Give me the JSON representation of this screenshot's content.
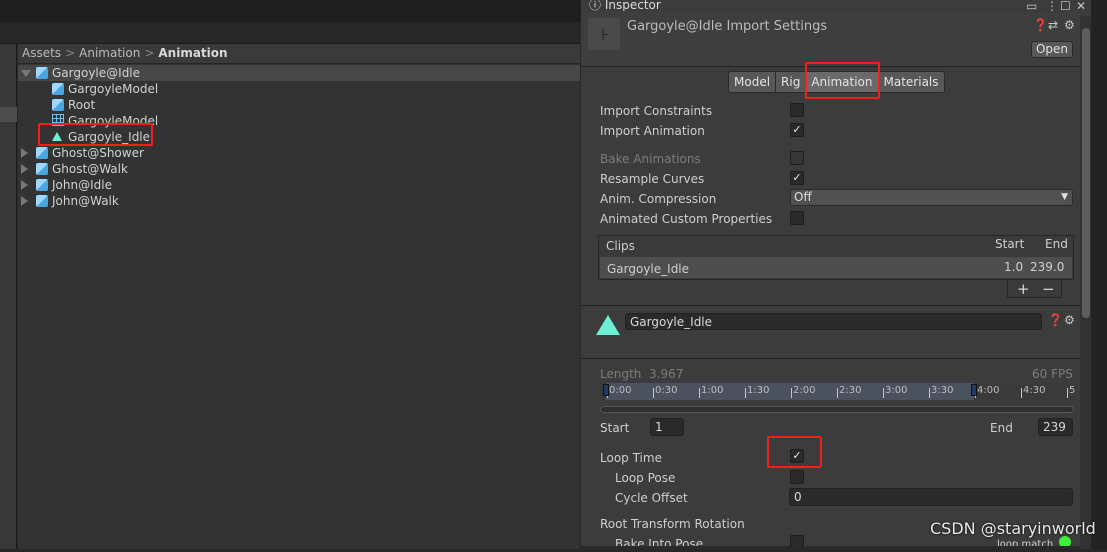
{
  "breadcrumb": [
    "Assets",
    "Animation",
    "Animation"
  ],
  "tree": [
    {
      "label": "Gargoyle@Idle",
      "icon": "model-prefab-icon",
      "expanded": true,
      "selected": true,
      "depth": 0
    },
    {
      "label": "GargoyleModel",
      "icon": "model-prefab-icon",
      "depth": 1
    },
    {
      "label": "Root",
      "icon": "model-prefab-icon",
      "depth": 1
    },
    {
      "label": "GargoyleModel",
      "icon": "mesh-icon",
      "depth": 1
    },
    {
      "label": "Gargoyle_Idle",
      "icon": "animation-clip-icon",
      "depth": 1,
      "highlighted": true
    },
    {
      "label": "Ghost@Shower",
      "icon": "model-prefab-icon",
      "expanded": false,
      "depth": 0
    },
    {
      "label": "Ghost@Walk",
      "icon": "model-prefab-icon",
      "expanded": false,
      "depth": 0
    },
    {
      "label": "John@Idle",
      "icon": "model-prefab-icon",
      "expanded": false,
      "depth": 0
    },
    {
      "label": "John@Walk",
      "icon": "model-prefab-icon",
      "expanded": false,
      "depth": 0
    }
  ],
  "inspector": {
    "tab_label": "Inspector",
    "title": "Gargoyle@Idle Import Settings",
    "open_label": "Open",
    "tabs": [
      "Model",
      "Rig",
      "Animation",
      "Materials"
    ],
    "active_tab": "Animation",
    "settings": [
      {
        "label": "Import Constraints",
        "checked": false
      },
      {
        "label": "Import Animation",
        "checked": true
      },
      {
        "label": "Bake Animations",
        "checked": false,
        "disabled": true
      },
      {
        "label": "Resample Curves",
        "checked": true
      },
      {
        "label": "Anim. Compression",
        "value": "Off"
      },
      {
        "label": "Animated Custom Properties",
        "checked": false
      }
    ],
    "clips": {
      "header": "Clips",
      "start_header": "Start",
      "end_header": "End",
      "rows": [
        {
          "name": "Gargoyle_Idle",
          "start": "1.0",
          "end": "239.0"
        }
      ],
      "add": "+",
      "remove": "−"
    },
    "clip": {
      "name": "Gargoyle_Idle",
      "length_label": "Length",
      "length": "3.967",
      "fps": "60 FPS",
      "ticks": [
        "0:00",
        "0:30",
        "1:00",
        "1:30",
        "2:00",
        "2:30",
        "3:00",
        "3:30",
        "4:00",
        "4:30",
        "5"
      ],
      "start_label": "Start",
      "start": "1",
      "end_label": "End",
      "end": "239",
      "loop_time_label": "Loop Time",
      "loop_time": true,
      "loop_pose_label": "Loop Pose",
      "loop_pose": false,
      "cycle_offset_label": "Cycle Offset",
      "cycle_offset": "0",
      "root_rotation_label": "Root Transform Rotation",
      "bake_into_pose_label": "Bake Into Pose",
      "loop_match_label": "loop match",
      "loop_match_color": "#3cf03c"
    }
  },
  "watermark": "CSDN @staryinworld",
  "colors": {
    "highlight": "#f0201a",
    "clip_icon": "#6ef0d6",
    "model_icon": "#6cc0f0"
  }
}
